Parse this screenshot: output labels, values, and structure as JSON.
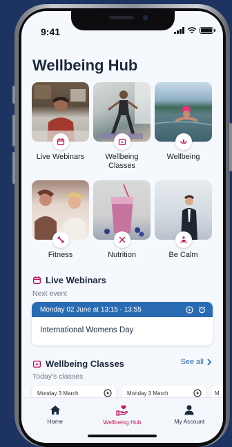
{
  "status": {
    "time": "9:41"
  },
  "header": {
    "title": "Wellbeing Hub"
  },
  "tiles": [
    {
      "label": "Live Webinars",
      "icon": "calendar-icon"
    },
    {
      "label": "Wellbeing Classes",
      "icon": "play-calendar-icon"
    },
    {
      "label": "Wellbeing",
      "icon": "lotus-icon"
    },
    {
      "label": "Fitness",
      "icon": "dumbbell-icon"
    },
    {
      "label": "Nutrition",
      "icon": "utensils-icon"
    },
    {
      "label": "Be Calm",
      "icon": "meditation-icon"
    }
  ],
  "live_webinars": {
    "title": "Live Webinars",
    "subtitle": "Next event",
    "event": {
      "datetime": "Monday 02 June at 13:15 - 13:55",
      "name": "International Womens Day"
    }
  },
  "classes": {
    "title": "Wellbeing Classes",
    "see_all": "See all",
    "subtitle": "Today's classes",
    "cards": [
      {
        "date": "Monday 3 March"
      },
      {
        "date": "Monday 3 March"
      },
      {
        "date": "M"
      }
    ]
  },
  "tabbar": {
    "tabs": [
      {
        "label": "Home",
        "icon": "home-icon"
      },
      {
        "label": "Wellbeing Hub",
        "icon": "heart-hand-icon",
        "active": true
      },
      {
        "label": "My Account",
        "icon": "person-icon"
      }
    ]
  },
  "colors": {
    "accent": "#2a6cb4",
    "pink": "#c2185b",
    "title": "#1b2a3d"
  }
}
